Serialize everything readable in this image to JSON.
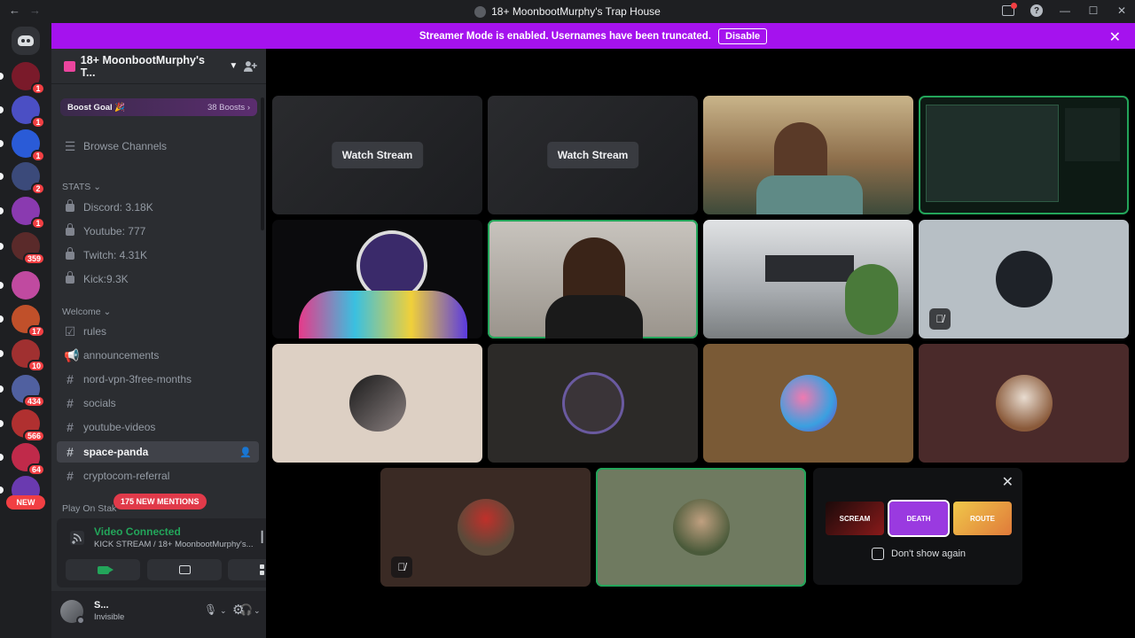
{
  "window": {
    "title": "18+ MoonbootMurphy's Trap House"
  },
  "banner": {
    "text": "Streamer Mode is enabled. Usernames have been truncated.",
    "button": "Disable"
  },
  "guilds": [
    {
      "badge": "1",
      "color": "#7a1a2a"
    },
    {
      "badge": "1",
      "color": "#4b4fc4"
    },
    {
      "badge": "1",
      "color": "#2a5bd7"
    },
    {
      "badge": "2",
      "color": "#3b4a7a"
    },
    {
      "badge": "1",
      "color": "#8a3ab0"
    },
    {
      "badge": "359",
      "color": "#5a2a2a"
    },
    {
      "badge": "",
      "color": "#c04aa0"
    },
    {
      "badge": "17",
      "color": "#c0502a"
    },
    {
      "badge": "10",
      "color": "#a03030"
    },
    {
      "badge": "434",
      "color": "#5060a0"
    },
    {
      "badge": "566",
      "color": "#b03030"
    },
    {
      "badge": "64",
      "color": "#c02a4a"
    },
    {
      "badge": "",
      "color": "#6a3ab0"
    }
  ],
  "guild_new": "NEW",
  "server": {
    "name": "18+ MoonbootMurphy's T...",
    "boost_label": "Boost Goal 🎉",
    "boost_count": "38 Boosts ›"
  },
  "channels": {
    "browse": "Browse Channels",
    "stats_cat": "STATS ⌄",
    "stats": [
      "Discord: 3.18K",
      "Youtube: 777",
      "Twitch: 4.31K",
      "Kick:9.3K"
    ],
    "welcome_cat": "Welcome ⌄",
    "rules": "rules",
    "announcements": "announcements",
    "text": [
      "nord-vpn-3free-months",
      "socials",
      "youtube-videos",
      "space-panda",
      "cryptocom-referral"
    ],
    "play_cat": "Play On Stak",
    "mentions": "175 NEW MENTIONS"
  },
  "voice": {
    "status": "Video Connected",
    "sub": "KICK STREAM / 18+ MoonbootMurphy's..."
  },
  "user": {
    "name": "S...",
    "status": "Invisible"
  },
  "stage": {
    "watch_label": "Watch Stream",
    "dont_show": "Don't show again",
    "promo": [
      "SCREAM",
      "DEATH",
      "ROUTE"
    ]
  }
}
